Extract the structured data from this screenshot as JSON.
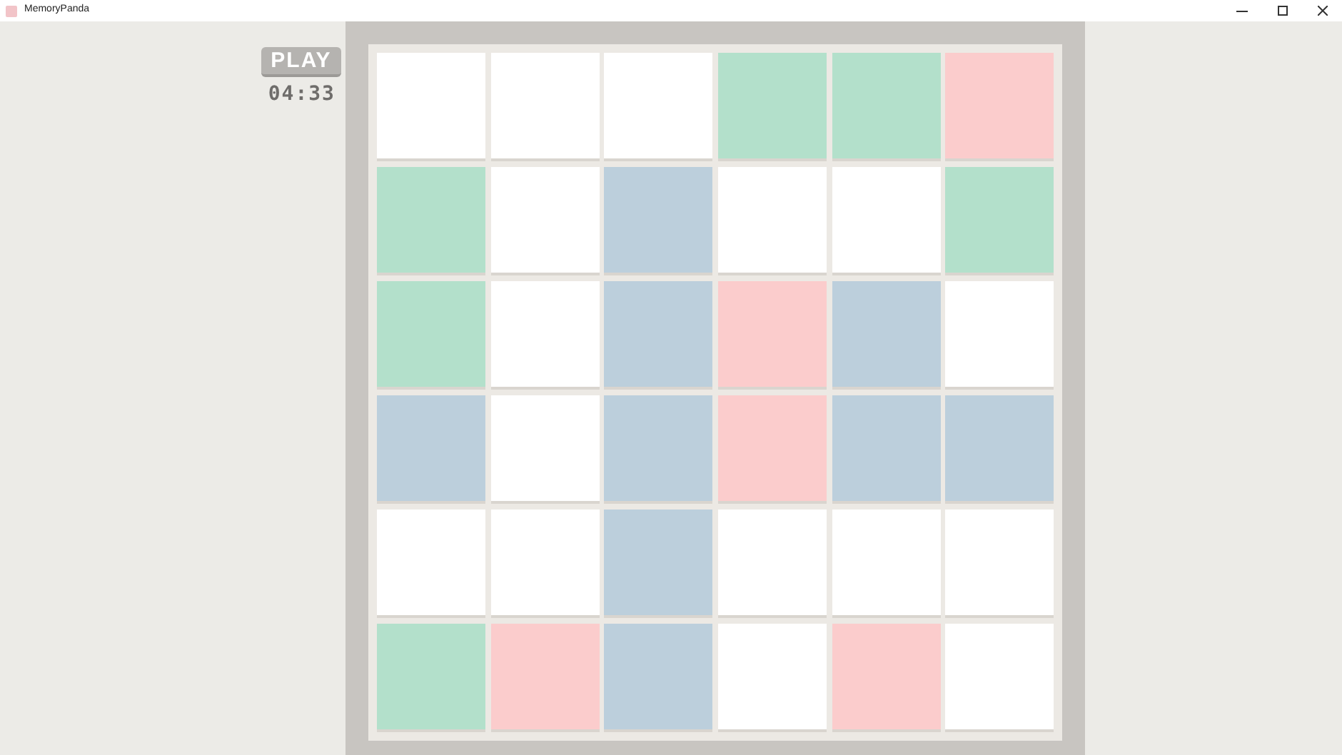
{
  "window": {
    "title": "MemoryPanda"
  },
  "play_button": {
    "label": "PLAY"
  },
  "timer": "04:33",
  "board": {
    "rows": [
      [
        {
          "color": "#ffffff"
        },
        {
          "color": "#ffffff"
        },
        {
          "color": "#ffffff"
        },
        {
          "color": "#b3e0cb"
        },
        {
          "color": "#b3e0cb"
        },
        {
          "color": "#fbcccc"
        }
      ],
      [
        {
          "color": "#b3e0cb"
        },
        {
          "color": "#ffffff"
        },
        {
          "color": "#bccfdc"
        },
        {
          "color": "#ffffff"
        },
        {
          "color": "#ffffff"
        },
        {
          "color": "#b3e0cb"
        }
      ],
      [
        {
          "color": "#b3e0cb"
        },
        {
          "color": "#ffffff"
        },
        {
          "color": "#bccfdc"
        },
        {
          "color": "#fbcccc"
        },
        {
          "color": "#bccfdc"
        },
        {
          "color": "#ffffff"
        }
      ],
      [
        {
          "color": "#bccfdc"
        },
        {
          "color": "#ffffff"
        },
        {
          "color": "#bccfdc"
        },
        {
          "color": "#fbcccc"
        },
        {
          "color": "#bccfdc"
        },
        {
          "color": "#bccfdc"
        }
      ],
      [
        {
          "color": "#ffffff"
        },
        {
          "color": "#ffffff"
        },
        {
          "color": "#bccfdc"
        },
        {
          "color": "#ffffff"
        },
        {
          "color": "#ffffff"
        },
        {
          "color": "#ffffff"
        }
      ],
      [
        {
          "color": "#b3e0cb"
        },
        {
          "color": "#fbcccc"
        },
        {
          "color": "#bccfdc"
        },
        {
          "color": "#ffffff"
        },
        {
          "color": "#fbcccc"
        },
        {
          "color": "#ffffff"
        }
      ]
    ]
  }
}
